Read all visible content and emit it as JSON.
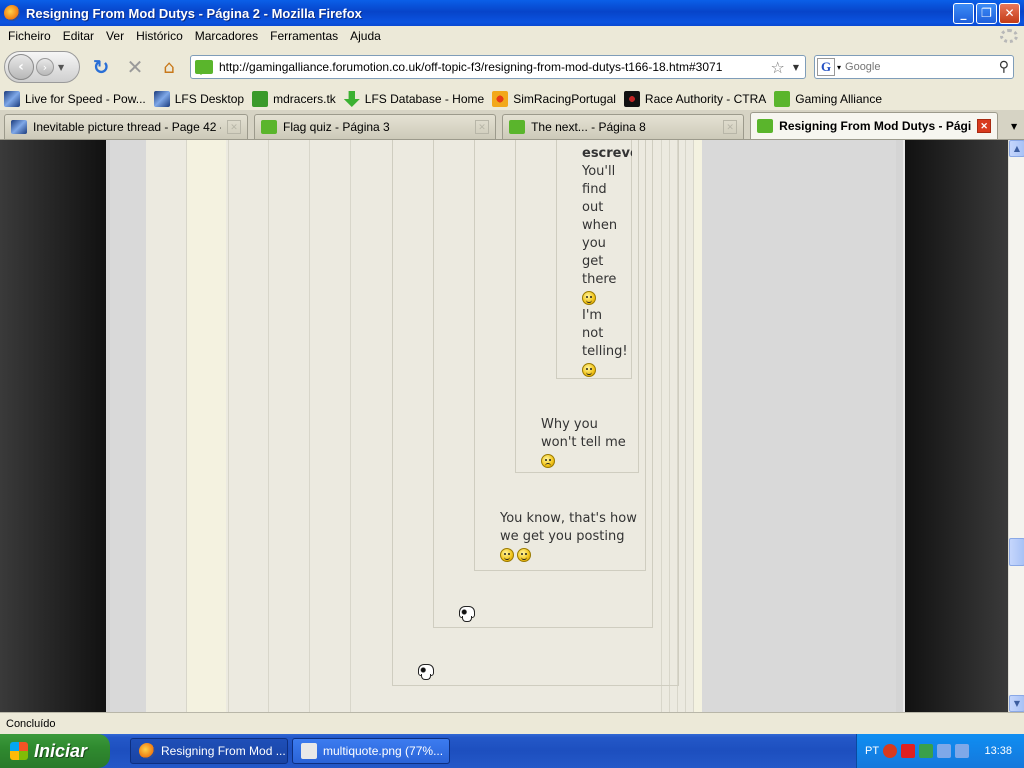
{
  "window": {
    "title": "Resigning From Mod Dutys - Página 2 - Mozilla Firefox"
  },
  "menu": [
    "Ficheiro",
    "Editar",
    "Ver",
    "Histórico",
    "Marcadores",
    "Ferramentas",
    "Ajuda"
  ],
  "nav": {
    "url": "http://gamingalliance.forumotion.co.uk/off-topic-f3/resigning-from-mod-dutys-t166-18.htm#3071",
    "search_placeholder": "Google"
  },
  "bookmarks": [
    {
      "label": "Live for Speed - Pow...",
      "icon": "lfs-icon"
    },
    {
      "label": "LFS Desktop",
      "icon": "lfs-icon"
    },
    {
      "label": "mdracers.tk",
      "icon": "mdracers-icon"
    },
    {
      "label": "LFS Database - Home",
      "icon": "download-icon"
    },
    {
      "label": "SimRacingPortugal",
      "icon": "simracing-icon"
    },
    {
      "label": "Race Authority - CTRA",
      "icon": "race-authority-icon"
    },
    {
      "label": "Gaming Alliance",
      "icon": "speech-bubble-icon"
    }
  ],
  "tabs": [
    {
      "label": "Inevitable picture thread - Page 42 - Li...",
      "active": false
    },
    {
      "label": "Flag quiz - Página 3",
      "active": false
    },
    {
      "label": "The next... - Página 8",
      "active": false
    },
    {
      "label": "Resigning From Mod Dutys - Pági...",
      "active": true
    }
  ],
  "posts": {
    "q1_author_partial": "escreve",
    "q1_text_a": [
      "You'll",
      "find",
      "out",
      "when",
      "you",
      "get",
      "there"
    ],
    "q1_text_b": [
      "I'm",
      "not",
      "telling!"
    ],
    "q2_text": [
      "Why you",
      "won't tell me"
    ],
    "q3_text": [
      "You know, that's how",
      "we get you posting"
    ]
  },
  "status": {
    "text": "Concluído"
  },
  "taskbar": {
    "start": "Iniciar",
    "buttons": [
      "Resigning From Mod ...",
      "multiquote.png (77%..."
    ],
    "lang": "PT",
    "clock": "13:38"
  },
  "colors": {
    "titlebar": "#0a5fe8",
    "forum_bg": "#eceae0",
    "taskbar": "#2458c8"
  }
}
